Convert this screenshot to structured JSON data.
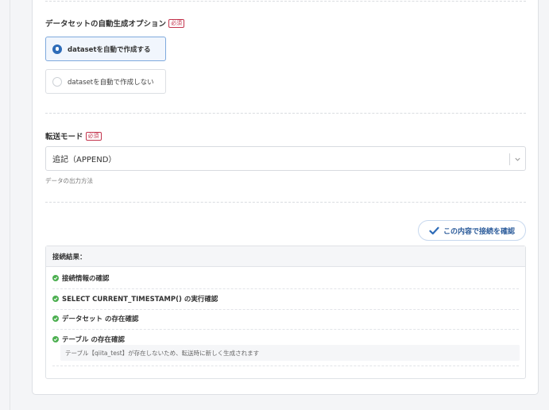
{
  "dataset_option": {
    "label": "データセットの自動生成オプション",
    "required_badge": "必須",
    "options": [
      {
        "label": "datasetを自動で作成する",
        "selected": true
      },
      {
        "label": "datasetを自動で作成しない",
        "selected": false
      }
    ]
  },
  "transfer_mode": {
    "label": "転送モード",
    "required_badge": "必須",
    "selected_value": "追記（APPEND）",
    "help_text": "データの出力方法"
  },
  "confirm_button": {
    "label": "この内容で接続を確認"
  },
  "connection_result": {
    "title": "接続結果：",
    "checks": [
      {
        "label": "接続情報の確認",
        "status": "ok"
      },
      {
        "label": "SELECT CURRENT_TIMESTAMP() の実行確認",
        "status": "ok"
      },
      {
        "label": "データセット の存在確認",
        "status": "ok"
      },
      {
        "label": "テーブル の存在確認",
        "status": "ok",
        "note": "テーブル【qiita_test】が存在しないため、転送時に新しく生成されます"
      }
    ]
  },
  "colors": {
    "accent": "#2e6cb8",
    "success": "#4caf50",
    "required": "#c3344d"
  },
  "icons": {
    "check": "check-icon",
    "success": "check-circle-icon",
    "dropdown": "chevron-down-icon"
  }
}
